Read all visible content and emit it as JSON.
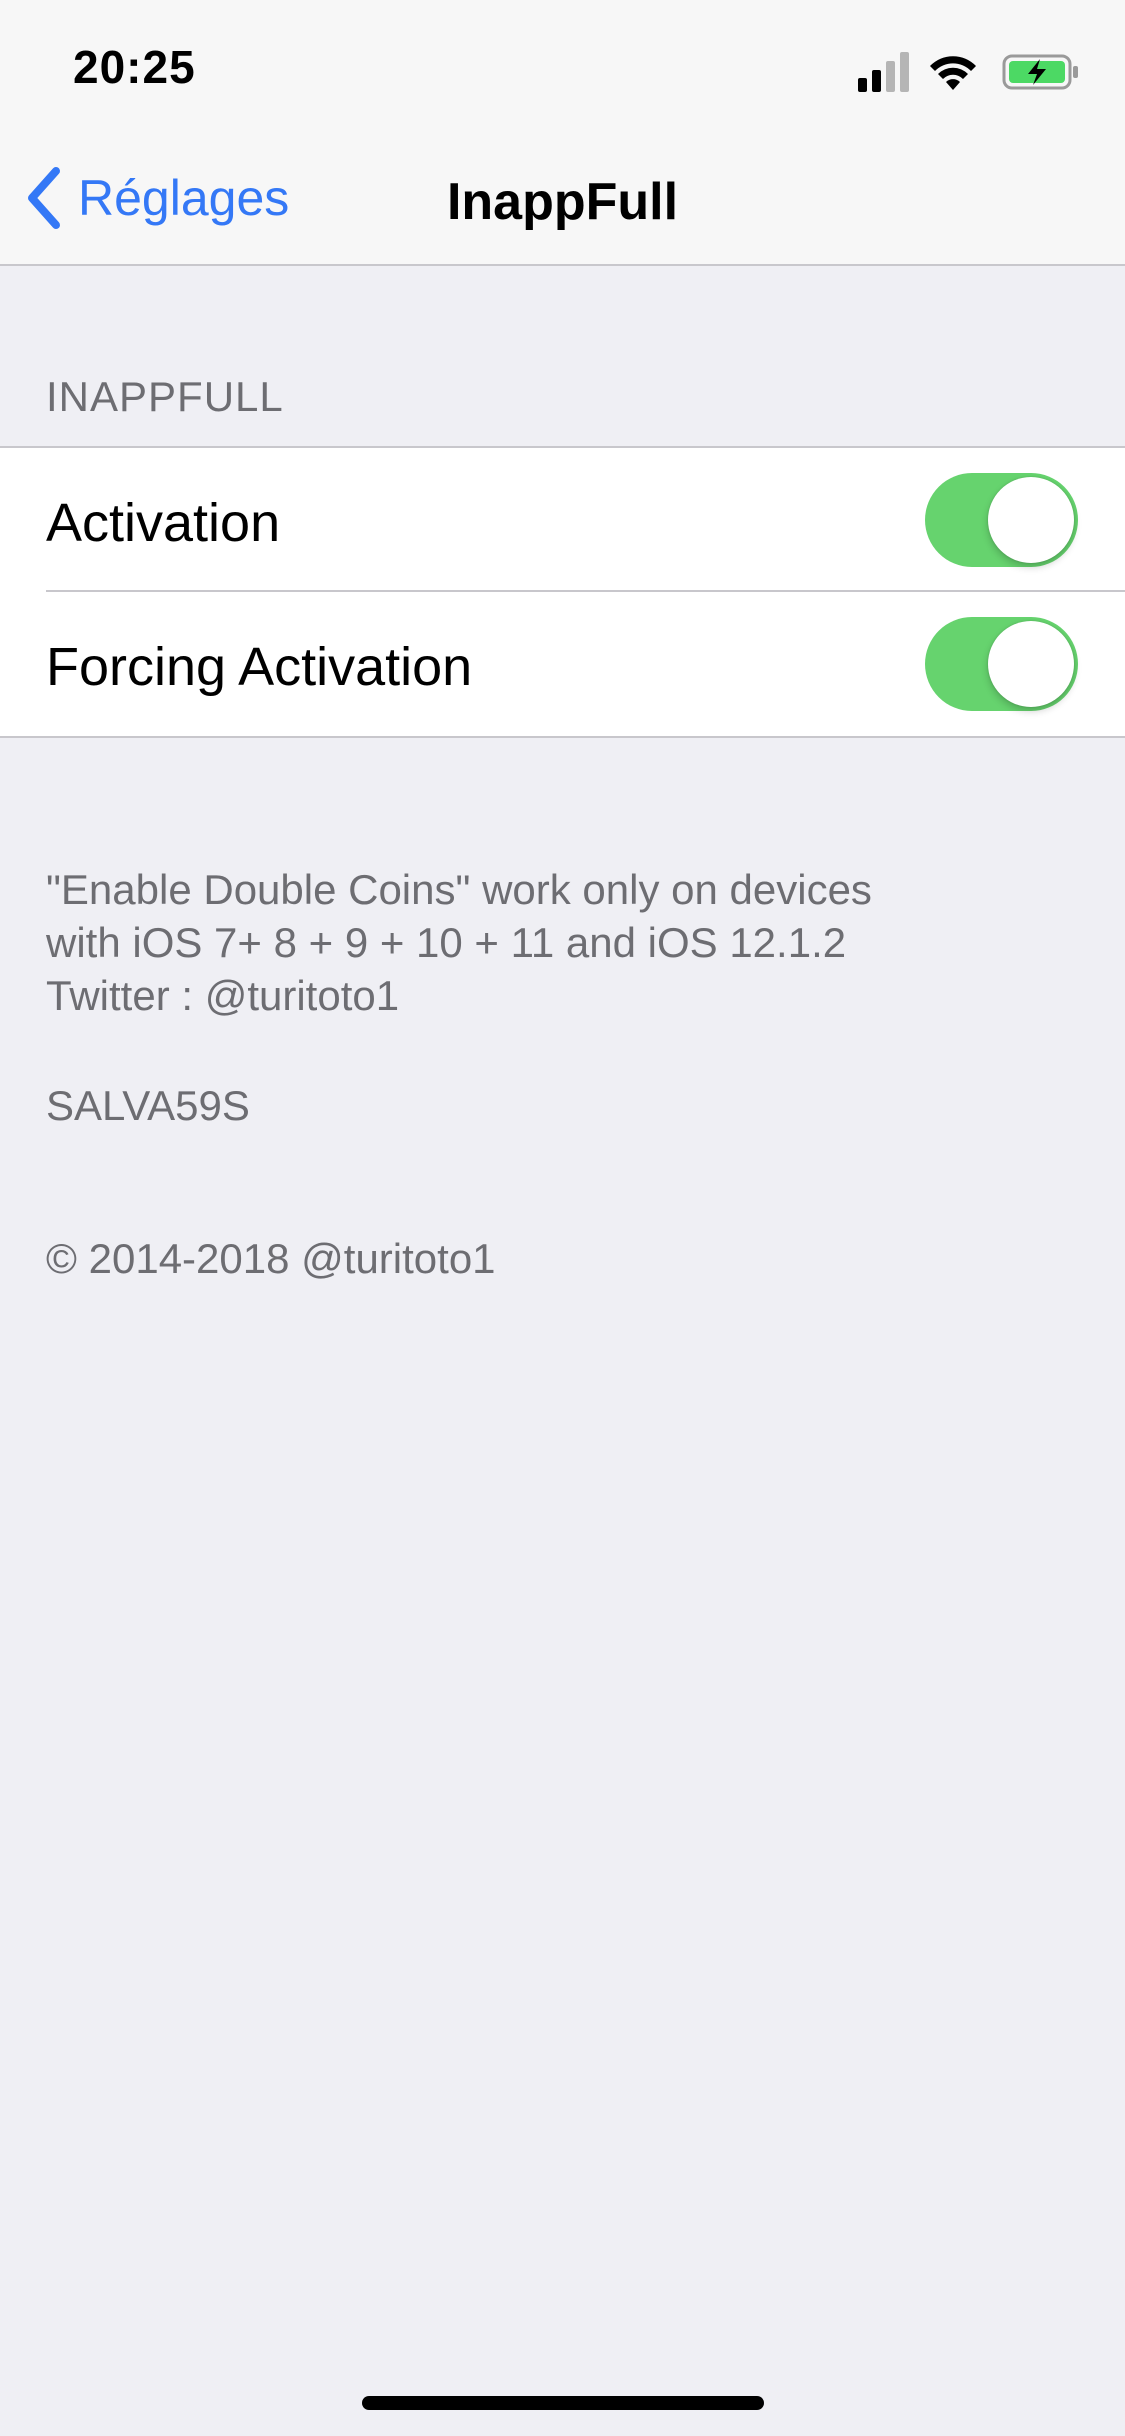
{
  "status_bar": {
    "time": "20:25",
    "icons": [
      "signal-icon",
      "wifi-icon",
      "battery-charging-icon"
    ],
    "battery_color": "#4CD964"
  },
  "nav": {
    "back_label": "Réglages",
    "title": "InappFull"
  },
  "section": {
    "header": "INAPPFULL",
    "rows": [
      {
        "label": "Activation",
        "toggle_on": true
      },
      {
        "label": "Forcing Activation",
        "toggle_on": true
      }
    ]
  },
  "footer": {
    "lines": [
      "\"Enable Double Coins\" work only on devices",
      "with iOS 7+ 8 + 9 + 10 + 11 and iOS 12.1.2",
      "Twitter : @turitoto1"
    ],
    "code": "SALVA59S",
    "copyright": "© 2014-2018 @turitoto1"
  },
  "colors": {
    "accent": "#3478F6",
    "toggle_on": "#66D36E",
    "background": "#EFEFF4",
    "footer_text": "#6D6D72"
  }
}
